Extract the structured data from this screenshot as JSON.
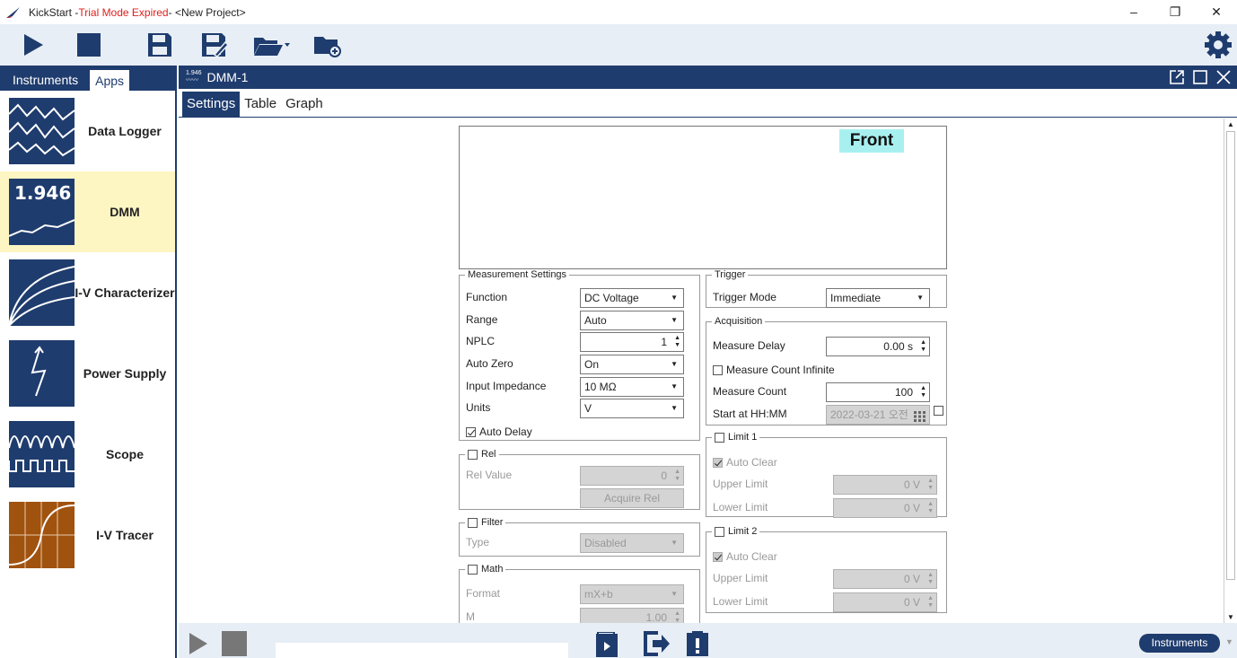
{
  "window": {
    "app_name": "KickStart - ",
    "mode": "Trial Mode Expired",
    "project": " - <New Project>",
    "controls": [
      "–",
      "❐",
      "✕"
    ]
  },
  "left": {
    "tabs": [
      "Instruments",
      "Apps"
    ],
    "apps": [
      {
        "label": "Data Logger",
        "icon": "data-logger-icon"
      },
      {
        "label": "DMM",
        "icon": "dmm-icon",
        "icon_text": "1.946",
        "selected": true
      },
      {
        "label": "I-V Characterizer",
        "icon": "iv-characterizer-icon"
      },
      {
        "label": "Power Supply",
        "icon": "power-supply-icon"
      },
      {
        "label": "Scope",
        "icon": "scope-icon"
      },
      {
        "label": "I-V Tracer",
        "icon": "iv-tracer-icon"
      }
    ]
  },
  "main": {
    "mini_icon_text": "1.946",
    "title": "DMM-1",
    "tabs": [
      "Settings",
      "Table",
      "Graph"
    ],
    "front_label": "Front"
  },
  "measurement": {
    "legend": "Measurement Settings",
    "function_label": "Function",
    "function_value": "DC Voltage",
    "range_label": "Range",
    "range_value": "Auto",
    "nplc_label": "NPLC",
    "nplc_value": "1",
    "autozero_label": "Auto Zero",
    "autozero_value": "On",
    "impedance_label": "Input Impedance",
    "impedance_value": "10 MΩ",
    "units_label": "Units",
    "units_value": "V",
    "autodelay_label": "Auto Delay"
  },
  "rel": {
    "legend": "Rel",
    "value_label": "Rel Value",
    "value": "0",
    "acquire_label": "Acquire Rel"
  },
  "filter": {
    "legend": "Filter",
    "type_label": "Type",
    "type_value": "Disabled"
  },
  "math": {
    "legend": "Math",
    "format_label": "Format",
    "format_value": "mX+b",
    "m_label": "M",
    "m_value": "1.00"
  },
  "trigger": {
    "legend": "Trigger",
    "mode_label": "Trigger Mode",
    "mode_value": "Immediate"
  },
  "acquisition": {
    "legend": "Acquisition",
    "delay_label": "Measure Delay",
    "delay_value": "0.00 s",
    "infinite_label": "Measure Count Infinite",
    "count_label": "Measure Count",
    "count_value": "100",
    "start_label": "Start at HH:MM",
    "start_value": "2022-03-21 오전"
  },
  "limit1": {
    "legend": "Limit 1",
    "autoclear_label": "Auto Clear",
    "upper_label": "Upper Limit",
    "upper_value": "0 V",
    "lower_label": "Lower Limit",
    "lower_value": "0 V"
  },
  "limit2": {
    "legend": "Limit 2",
    "autoclear_label": "Auto Clear",
    "upper_label": "Upper Limit",
    "upper_value": "0 V",
    "lower_label": "Lower Limit",
    "lower_value": "0 V"
  },
  "bottom": {
    "instruments_button": "Instruments"
  },
  "colors": {
    "navy": "#1f3c6e",
    "selected_bg": "#fdf6c3",
    "front_bg": "#a8f0f0",
    "trial_red": "#e0201c",
    "brown": "#a0520f"
  }
}
